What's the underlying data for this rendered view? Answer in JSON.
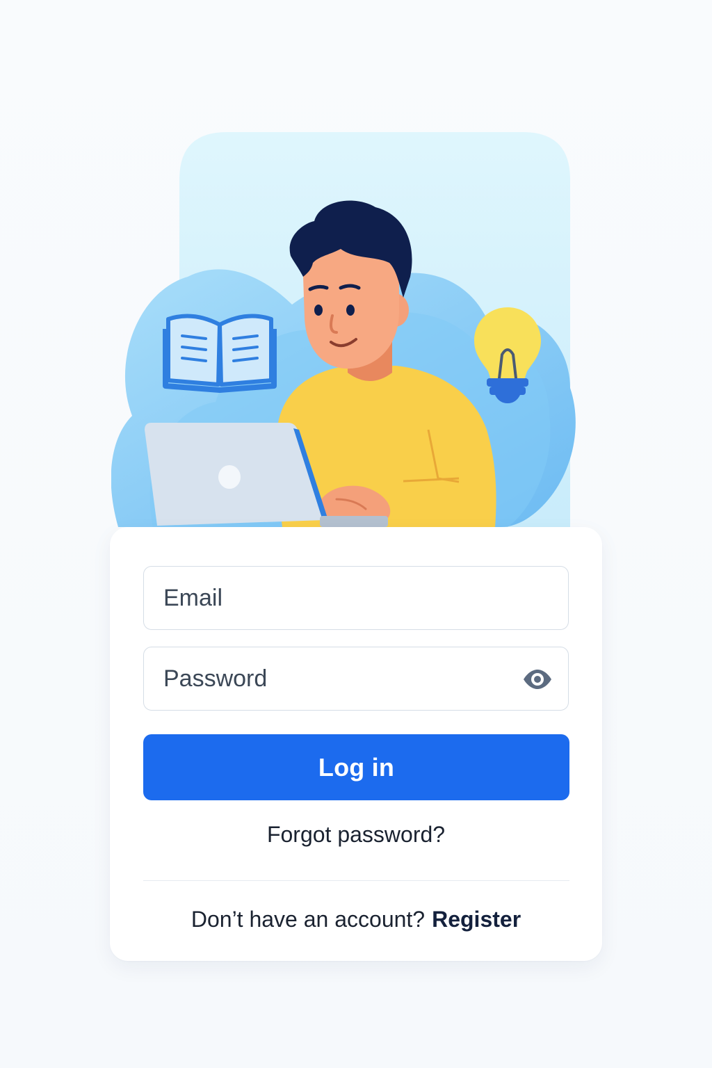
{
  "form": {
    "email_placeholder": "Email",
    "password_placeholder": "Password",
    "login_label": "Log in",
    "forgot_label": "Forgot password?",
    "no_account_text": "Don’t have an account?",
    "register_label": "Register"
  },
  "icons": {
    "password_toggle": "eye-icon"
  },
  "illustration": {
    "elements": [
      "person-illustration",
      "laptop-illustration",
      "open-book-icon",
      "lightbulb-icon"
    ]
  },
  "colors": {
    "primary": "#1c6bee",
    "background": "#f8fafc",
    "card": "#ffffff",
    "shirt": "#f9cf4a",
    "hair": "#0f1f4d",
    "bubble": "#7cc8f4"
  }
}
